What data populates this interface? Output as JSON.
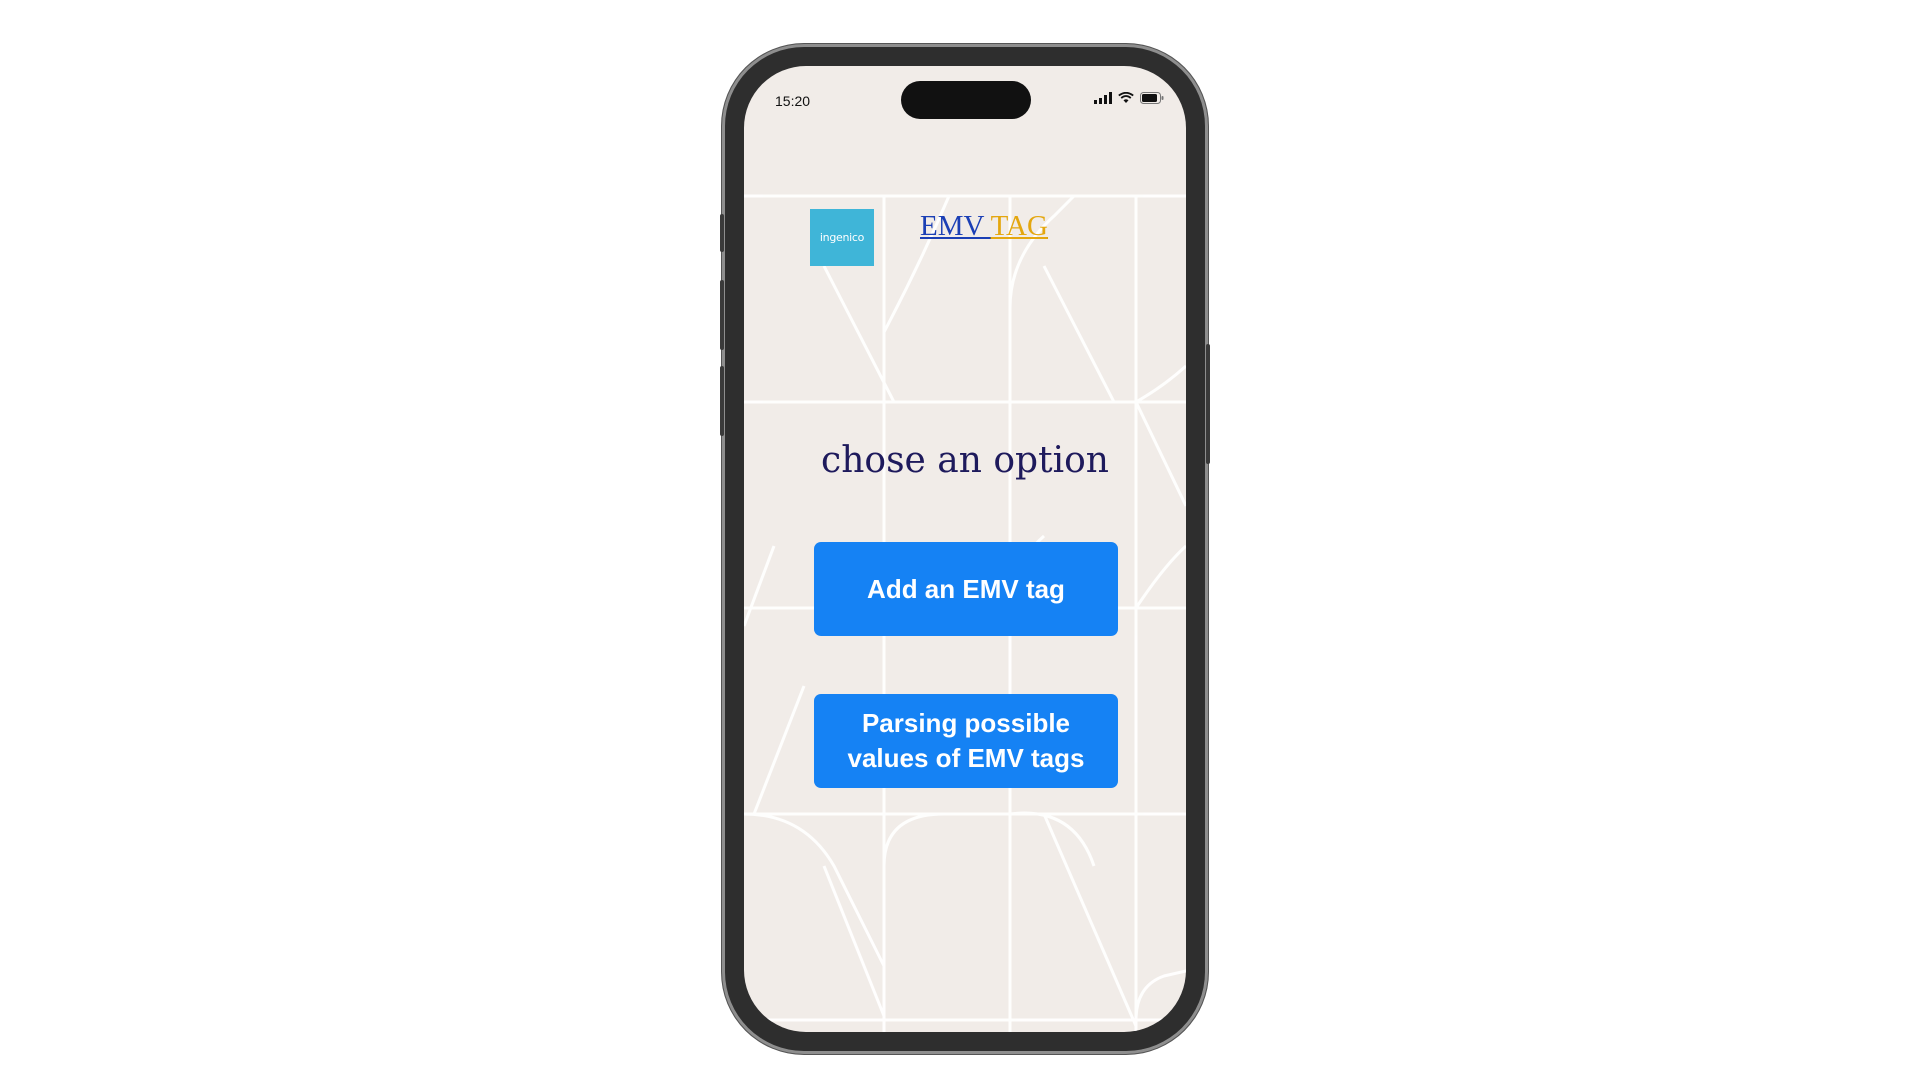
{
  "status_bar": {
    "time": "15:20",
    "icons": [
      "signal-icon",
      "wifi-icon",
      "battery-icon"
    ]
  },
  "header": {
    "logo_text": "ingenico",
    "title_part1": "EMV ",
    "title_part2": "TAG"
  },
  "main": {
    "prompt": "chose an option",
    "buttons": [
      {
        "label": "Add an EMV tag"
      },
      {
        "label": "Parsing possible values of EMV tags"
      }
    ]
  },
  "colors": {
    "background": "#f1ece8",
    "button": "#1582f4",
    "logo": "#3fb5d8",
    "title_emv": "#1b3fb5",
    "title_tag": "#e4a70f",
    "prompt": "#1e1a5c"
  }
}
